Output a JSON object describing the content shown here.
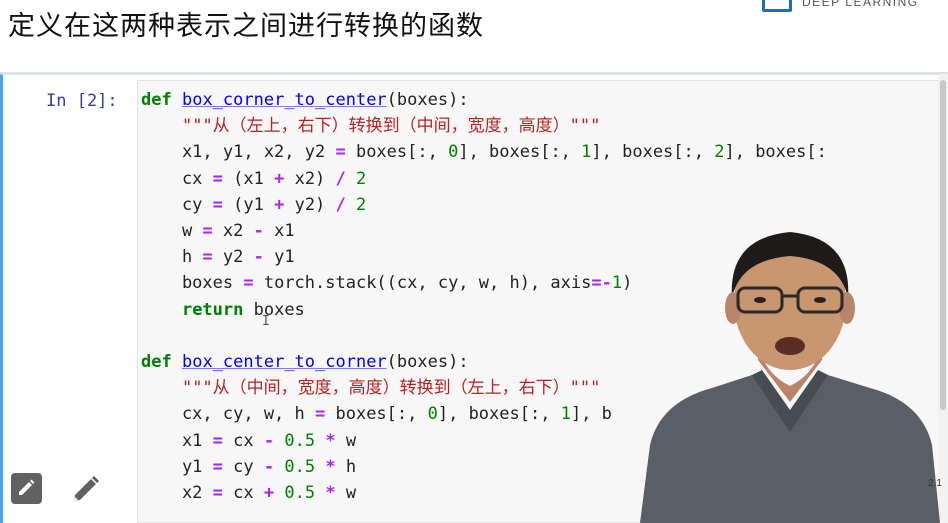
{
  "header": {
    "title": "定义在这两种表示之间进行转换的函数",
    "logo_text": "DEEP LEARNING"
  },
  "cell": {
    "prompt": "In [2]:",
    "lines": [
      [
        {
          "t": "def",
          "c": "kw"
        },
        {
          "t": " "
        },
        {
          "t": "box_corner_to_center",
          "c": "fn"
        },
        {
          "t": "(boxes):"
        }
      ],
      [
        {
          "t": "    "
        },
        {
          "t": "\"\"\"从（左上，右下）转换到（中间，宽度，高度）\"\"\"",
          "c": "st"
        }
      ],
      [
        {
          "t": "    x1, y1, x2, y2 "
        },
        {
          "t": "=",
          "c": "op"
        },
        {
          "t": " boxes[:, "
        },
        {
          "t": "0",
          "c": "nu"
        },
        {
          "t": "], boxes[:, "
        },
        {
          "t": "1",
          "c": "nu"
        },
        {
          "t": "], boxes[:, "
        },
        {
          "t": "2",
          "c": "nu"
        },
        {
          "t": "], boxes[:"
        }
      ],
      [
        {
          "t": "    cx "
        },
        {
          "t": "=",
          "c": "op"
        },
        {
          "t": " (x1 "
        },
        {
          "t": "+",
          "c": "op"
        },
        {
          "t": " x2) "
        },
        {
          "t": "/",
          "c": "op"
        },
        {
          "t": " "
        },
        {
          "t": "2",
          "c": "nu"
        }
      ],
      [
        {
          "t": "    cy "
        },
        {
          "t": "=",
          "c": "op"
        },
        {
          "t": " (y1 "
        },
        {
          "t": "+",
          "c": "op"
        },
        {
          "t": " y2) "
        },
        {
          "t": "/",
          "c": "op"
        },
        {
          "t": " "
        },
        {
          "t": "2",
          "c": "nu"
        }
      ],
      [
        {
          "t": "    w "
        },
        {
          "t": "=",
          "c": "op"
        },
        {
          "t": " x2 "
        },
        {
          "t": "-",
          "c": "op"
        },
        {
          "t": " x1"
        }
      ],
      [
        {
          "t": "    h "
        },
        {
          "t": "=",
          "c": "op"
        },
        {
          "t": " y2 "
        },
        {
          "t": "-",
          "c": "op"
        },
        {
          "t": " y1"
        }
      ],
      [
        {
          "t": "    boxes "
        },
        {
          "t": "=",
          "c": "op"
        },
        {
          "t": " torch.stack((cx, cy, w, h), axis"
        },
        {
          "t": "=-",
          "c": "op"
        },
        {
          "t": "1",
          "c": "nu"
        },
        {
          "t": ")"
        }
      ],
      [
        {
          "t": "    "
        },
        {
          "t": "return",
          "c": "kw"
        },
        {
          "t": " boxes"
        }
      ],
      [],
      [
        {
          "t": "def",
          "c": "kw"
        },
        {
          "t": " "
        },
        {
          "t": "box_center_to_corner",
          "c": "fn"
        },
        {
          "t": "(boxes):"
        }
      ],
      [
        {
          "t": "    "
        },
        {
          "t": "\"\"\"从（中间，宽度，高度）转换到（左上，右下）\"\"\"",
          "c": "st"
        }
      ],
      [
        {
          "t": "    cx, cy, w, h "
        },
        {
          "t": "=",
          "c": "op"
        },
        {
          "t": " boxes[:, "
        },
        {
          "t": "0",
          "c": "nu"
        },
        {
          "t": "], boxes[:, "
        },
        {
          "t": "1",
          "c": "nu"
        },
        {
          "t": "], b"
        }
      ],
      [
        {
          "t": "    x1 "
        },
        {
          "t": "=",
          "c": "op"
        },
        {
          "t": " cx "
        },
        {
          "t": "-",
          "c": "op"
        },
        {
          "t": " "
        },
        {
          "t": "0.5",
          "c": "nu"
        },
        {
          "t": " "
        },
        {
          "t": "*",
          "c": "op"
        },
        {
          "t": " w"
        }
      ],
      [
        {
          "t": "    y1 "
        },
        {
          "t": "=",
          "c": "op"
        },
        {
          "t": " cy "
        },
        {
          "t": "-",
          "c": "op"
        },
        {
          "t": " "
        },
        {
          "t": "0.5",
          "c": "nu"
        },
        {
          "t": " "
        },
        {
          "t": "*",
          "c": "op"
        },
        {
          "t": " h"
        }
      ],
      [
        {
          "t": "    x2 "
        },
        {
          "t": "=",
          "c": "op"
        },
        {
          "t": " cx "
        },
        {
          "t": "+",
          "c": "op"
        },
        {
          "t": " "
        },
        {
          "t": "0.5",
          "c": "nu"
        },
        {
          "t": " "
        },
        {
          "t": "*",
          "c": "op"
        },
        {
          "t": " w"
        }
      ]
    ],
    "cursor_glyph": "I"
  },
  "toolbar": {
    "edit_icon": "edit-square-icon",
    "pencil_icon": "pencil-icon"
  },
  "side_label": "2.1",
  "colors": {
    "cell_border": "#42a5f5",
    "prompt": "#303f9f",
    "keyword": "#008000",
    "function": "#0000ff",
    "string": "#ba2121",
    "operator": "#aa22ff"
  }
}
